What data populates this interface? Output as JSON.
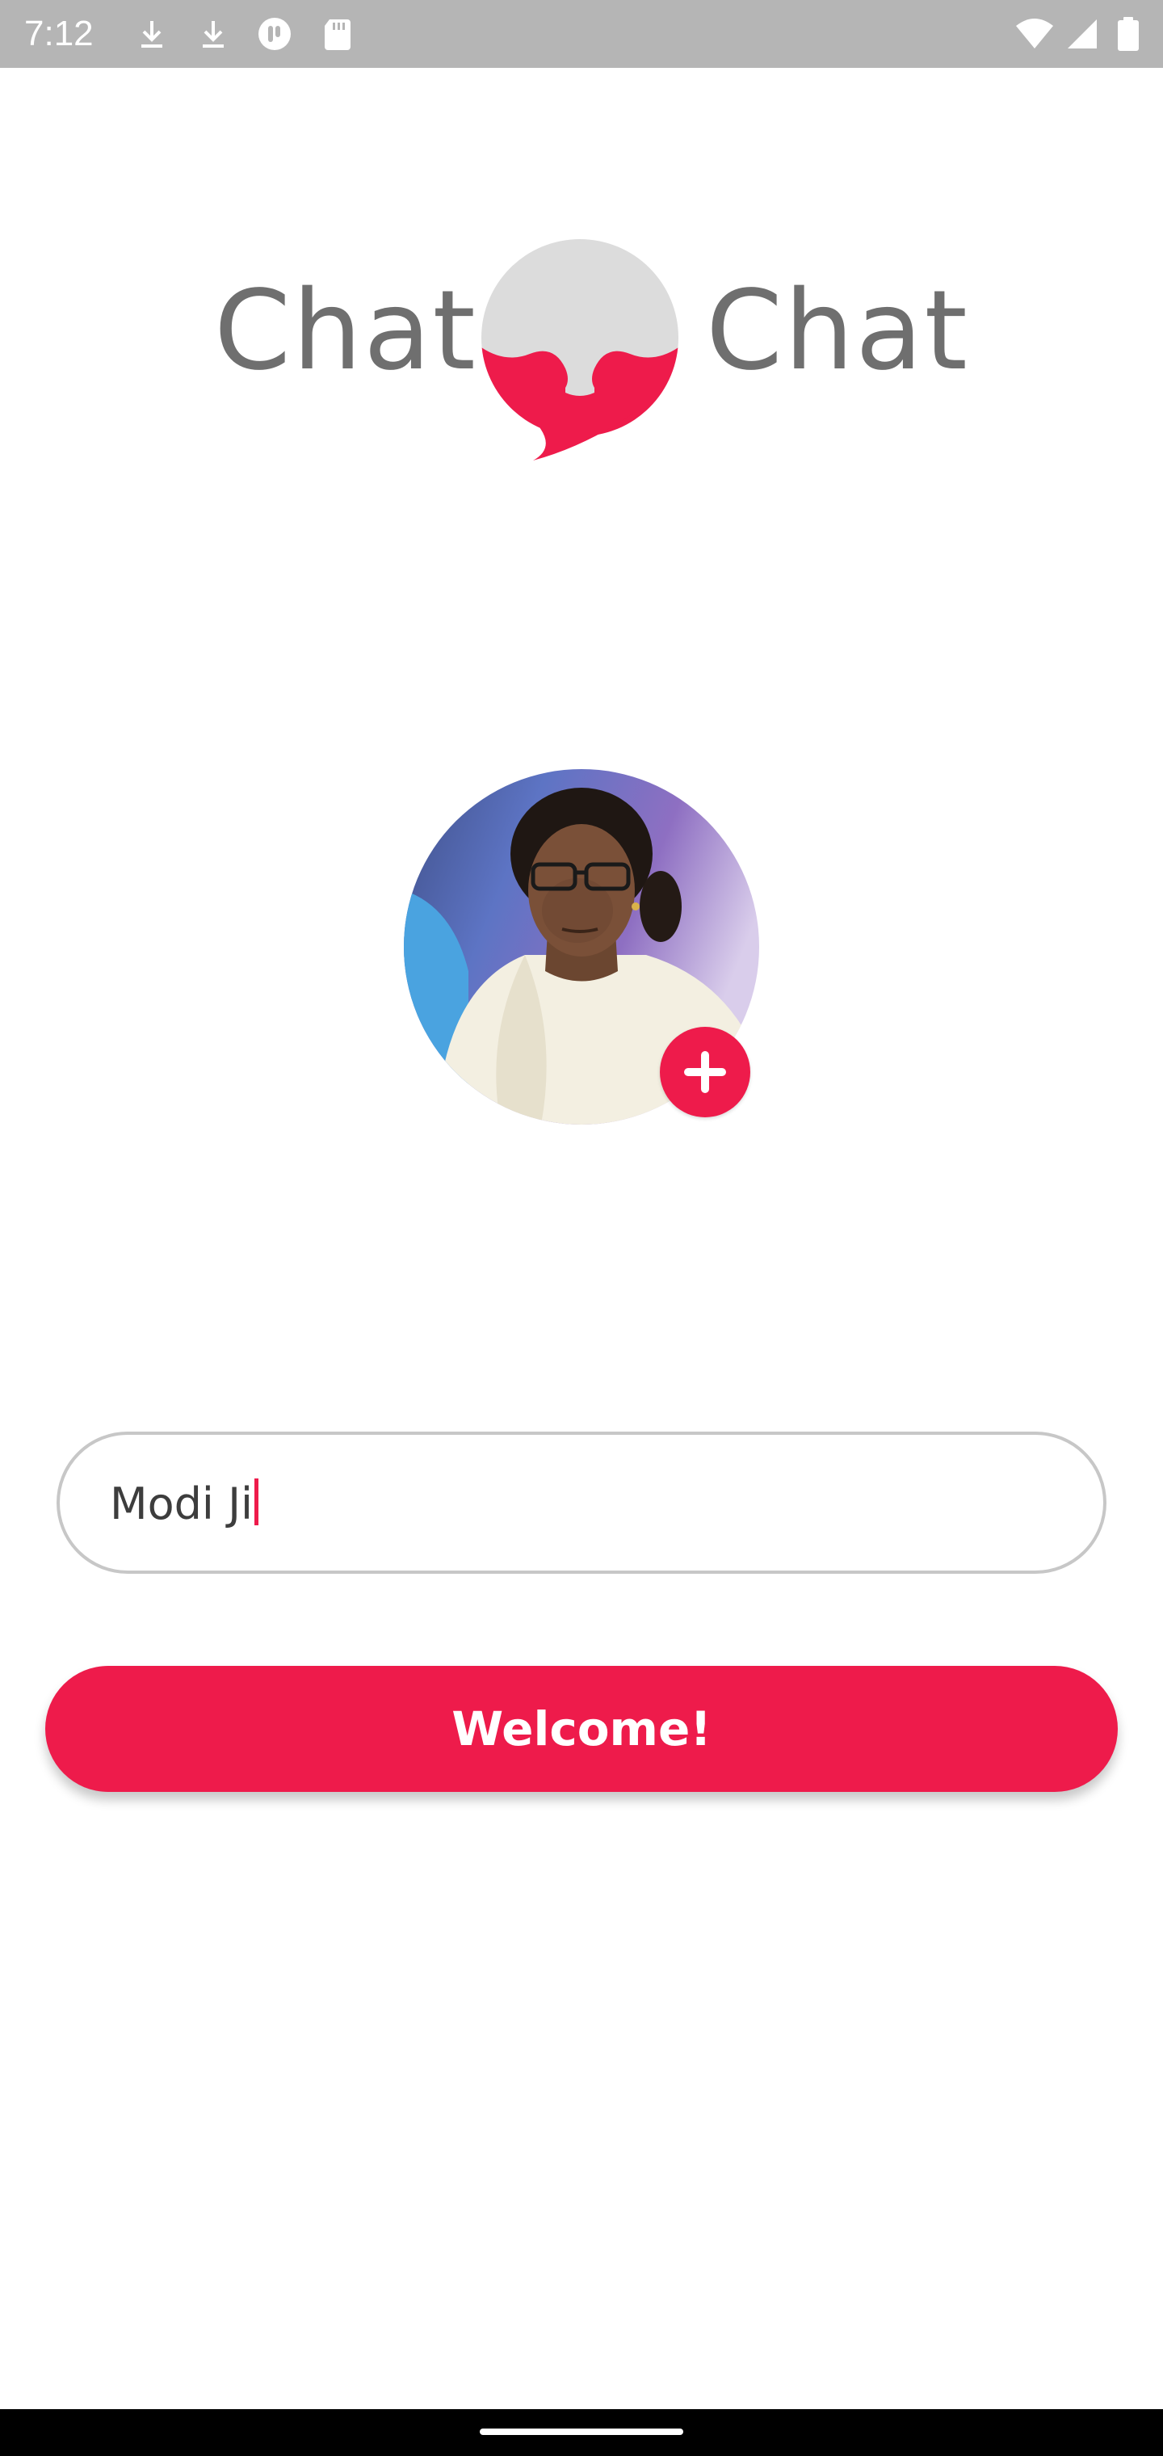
{
  "status_bar": {
    "time": "7:12",
    "icons": [
      "download-icon",
      "download-icon",
      "app-notification-icon",
      "sd-card-icon",
      "wifi-icon",
      "signal-icon",
      "battery-icon"
    ]
  },
  "logo": {
    "left_word": "Chat",
    "right_word": "Chat",
    "colors": {
      "text": "#6f6f6f",
      "bubble_top": "#dcdcdc",
      "bubble_bottom": "#ee1b4b"
    }
  },
  "avatar": {
    "add_button_icon": "plus-icon"
  },
  "name_field": {
    "value": "Modi Ji"
  },
  "welcome_button": {
    "label": "Welcome!"
  },
  "colors": {
    "accent": "#ee1b4b",
    "status_bar": "#b5b5b5",
    "field_border": "#c7c7c7"
  }
}
